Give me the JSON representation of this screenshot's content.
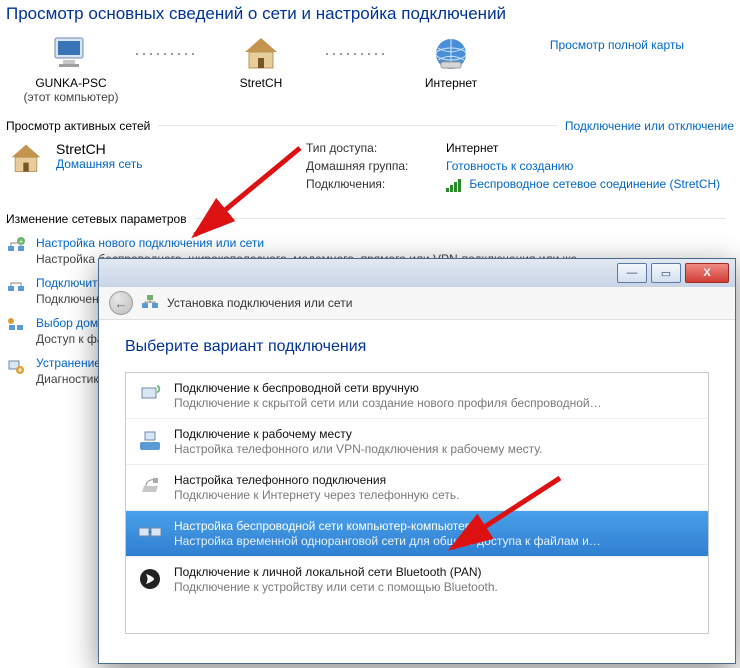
{
  "header": {
    "title": "Просмотр основных сведений о сети и настройка подключений"
  },
  "map": {
    "pc": {
      "name": "GUNKA-PSC",
      "sub": "(этот компьютер)"
    },
    "router": {
      "name": "StretCH"
    },
    "internet": {
      "name": "Интернет"
    },
    "view_full": "Просмотр полной карты"
  },
  "active": {
    "section": "Просмотр активных сетей",
    "connect_toggle": "Подключение или отключение",
    "name": "StretCH",
    "type_link": "Домашняя сеть",
    "info": {
      "access_label": "Тип доступа:",
      "access_value": "Интернет",
      "homegroup_label": "Домашняя группа:",
      "homegroup_value": "Готовность к созданию",
      "conn_label": "Подключения:",
      "conn_value": "Беспроводное сетевое соединение (StretCH)"
    }
  },
  "params": {
    "section": "Изменение сетевых параметров",
    "items": [
      {
        "title": "Настройка нового подключения или сети",
        "desc": "Настройка беспроводного, широкополосного, модемного, прямого или VPN-подключения или же …"
      },
      {
        "title": "Подключиться к сети",
        "desc": "Подключение или повторное подключение к беспроводному, проводному, модемному сетевому …"
      },
      {
        "title": "Выбор домашней группы и параметров общего доступа",
        "desc": "Доступ к файлам и принтерам, расположенным на других сетевых компьютерах, или изменение …"
      },
      {
        "title": "Устранение неполадок",
        "desc": "Диагностика и исправление сетевых проблем или получение сведений об исправлении."
      }
    ]
  },
  "dialog": {
    "window": {
      "min": "—",
      "max": "▭",
      "close": "X"
    },
    "header_icon": "←",
    "header": "Установка подключения или сети",
    "title": "Выберите вариант подключения",
    "options": [
      {
        "title": "Подключение к беспроводной сети вручную",
        "desc": "Подключение к скрытой сети или создание нового профиля беспроводной связи."
      },
      {
        "title": "Подключение к рабочему месту",
        "desc": "Настройка телефонного или VPN-подключения к рабочему месту."
      },
      {
        "title": "Настройка телефонного подключения",
        "desc": "Подключение к Интернету через телефонную сеть."
      },
      {
        "title": "Настройка беспроводной сети компьютер-компьютер",
        "desc": "Настройка временной одноранговой сети для общего доступа к файлам или к Инт…",
        "selected": true
      },
      {
        "title": "Подключение к личной локальной сети Bluetooth (PAN)",
        "desc": "Подключение к устройству или сети с помощью Bluetooth."
      }
    ]
  }
}
